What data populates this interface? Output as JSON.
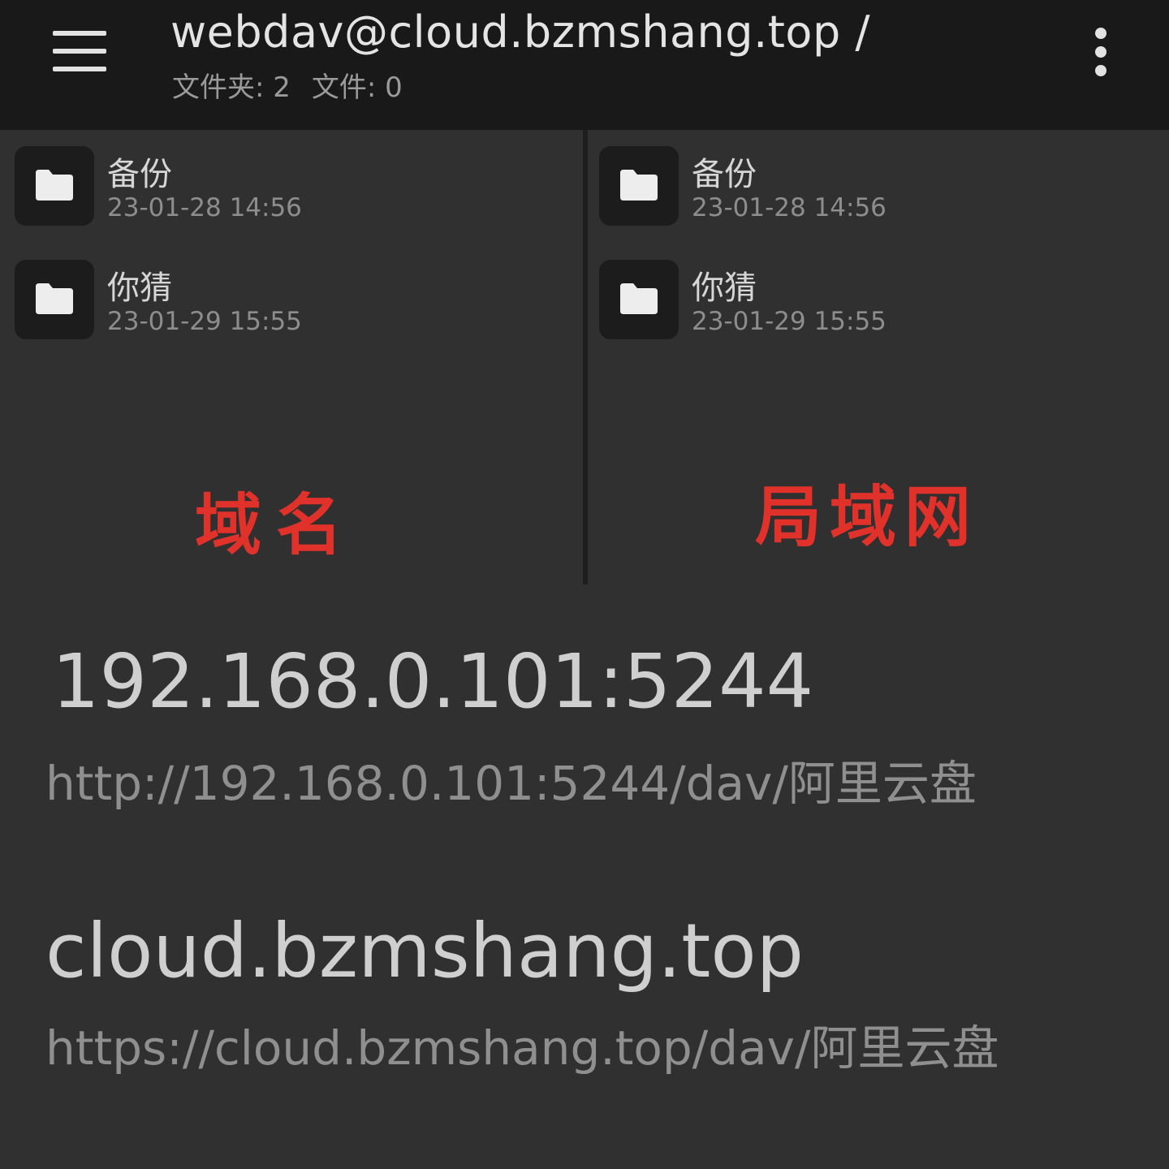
{
  "appbar": {
    "menu_icon": "hamburger-menu-icon",
    "title": "webdav@cloud.bzmshang.top  /",
    "folders_count": "文件夹: 2",
    "files_count": "文件: 0",
    "more_icon": "more-vertical-icon"
  },
  "left_pane": {
    "items": [
      {
        "icon": "folder-icon",
        "name": "备份",
        "date": "23-01-28 14:56"
      },
      {
        "icon": "folder-icon",
        "name": "你猜",
        "date": "23-01-29 15:55"
      }
    ],
    "annotation": "域名"
  },
  "right_pane": {
    "items": [
      {
        "icon": "folder-icon",
        "name": "备份",
        "date": "23-01-28 14:56"
      },
      {
        "icon": "folder-icon",
        "name": "你猜",
        "date": "23-01-29 15:55"
      }
    ],
    "annotation": "局域网"
  },
  "connections": [
    {
      "host": "192.168.0.101:5244",
      "url": "http://192.168.0.101:5244/dav/阿里云盘"
    },
    {
      "host": "cloud.bzmshang.top",
      "url": "https://cloud.bzmshang.top/dav/阿里云盘"
    }
  ],
  "colors": {
    "appbar_bg": "#191919",
    "page_bg": "#303030",
    "annotation_red": "#e0312a"
  }
}
